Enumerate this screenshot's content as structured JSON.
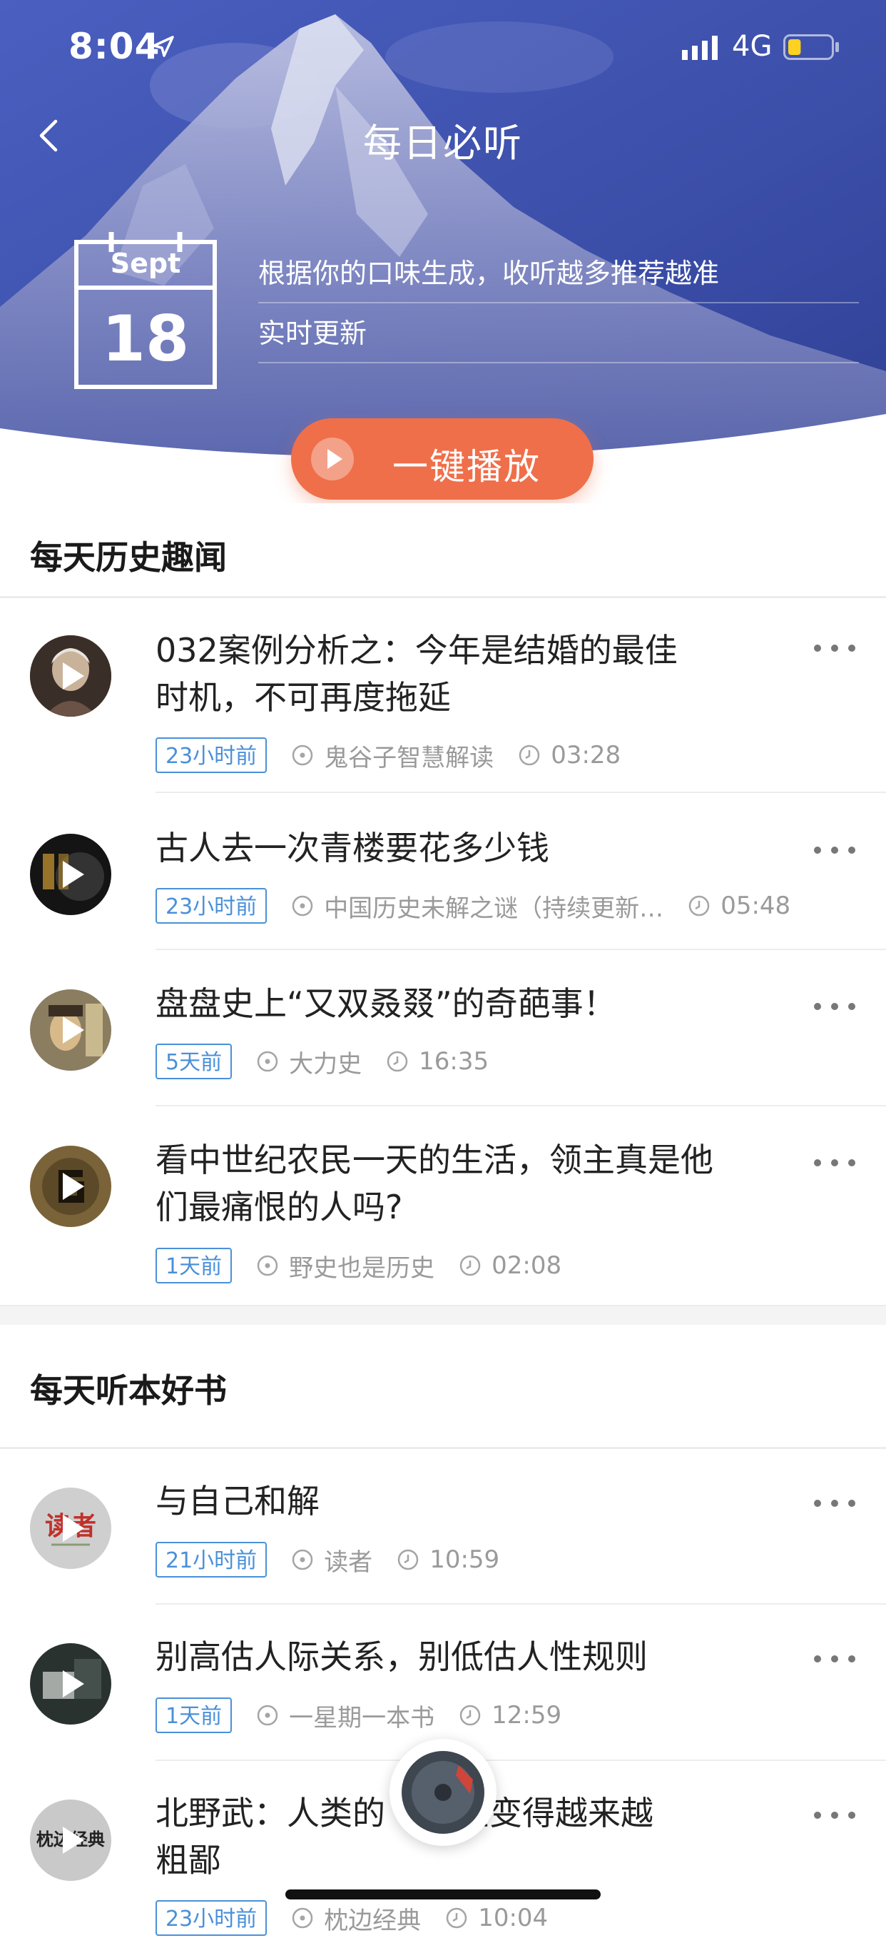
{
  "status_bar": {
    "time": "8:04",
    "network": "4G",
    "battery_level": 0.3
  },
  "nav": {
    "title": "每日必听"
  },
  "calendar": {
    "month": "Sept",
    "day": "18"
  },
  "info": {
    "line1": "根据你的口味生成，收听越多推荐越准",
    "line2": "实时更新"
  },
  "play_all": {
    "label": "一键播放"
  },
  "colors": {
    "accent": "#ef6f4a",
    "tag_blue": "#4a90d9",
    "meta_gray": "#9a9a9a",
    "hero_blue": "#3a4fa8"
  },
  "sections": [
    {
      "title": "每天历史趣闻",
      "items": [
        {
          "title_lines": [
            "032案例分析之：今年是结婚的最佳",
            "时机，不可再度拖延"
          ],
          "tag": "23小时前",
          "source": "鬼谷子智慧解读",
          "duration": "03:28"
        },
        {
          "title_lines": [
            "古人去一次青楼要花多少钱"
          ],
          "tag": "23小时前",
          "source": "中国历史未解之谜（持续更新…",
          "duration": "05:48"
        },
        {
          "title_lines": [
            "盘盘史上“又双叒叕”的奇葩事！"
          ],
          "tag": "5天前",
          "source": "大力史",
          "duration": "16:35"
        },
        {
          "title_lines": [
            "看中世纪农民一天的生活，领主真是他",
            "们最痛恨的人吗?"
          ],
          "tag": "1天前",
          "source": "野史也是历史",
          "duration": "02:08"
        }
      ]
    },
    {
      "title": "每天听本好书",
      "items": [
        {
          "title_lines": [
            "与自己和解"
          ],
          "tag": "21小时前",
          "source": "读者",
          "duration": "10:59"
        },
        {
          "title_lines": [
            "别高估人际关系，别低估人性规则"
          ],
          "tag": "1天前",
          "source": "一星期一本书",
          "duration": "12:59"
        },
        {
          "title_lines": [
            "北野武：人类的",
            "粗鄙"
          ],
          "title_visible_tail": "在变得越来越",
          "tag": "23小时前",
          "source": "枕边经典",
          "duration": "10:04"
        }
      ]
    }
  ],
  "cover_texts": {
    "item5": "读者",
    "item7": "枕边经典"
  },
  "icons": [
    "location-arrow-icon",
    "signal-icon",
    "battery-icon",
    "back-chevron-icon",
    "calendar-icon",
    "play-icon",
    "more-icon",
    "source-icon",
    "clock-icon"
  ]
}
